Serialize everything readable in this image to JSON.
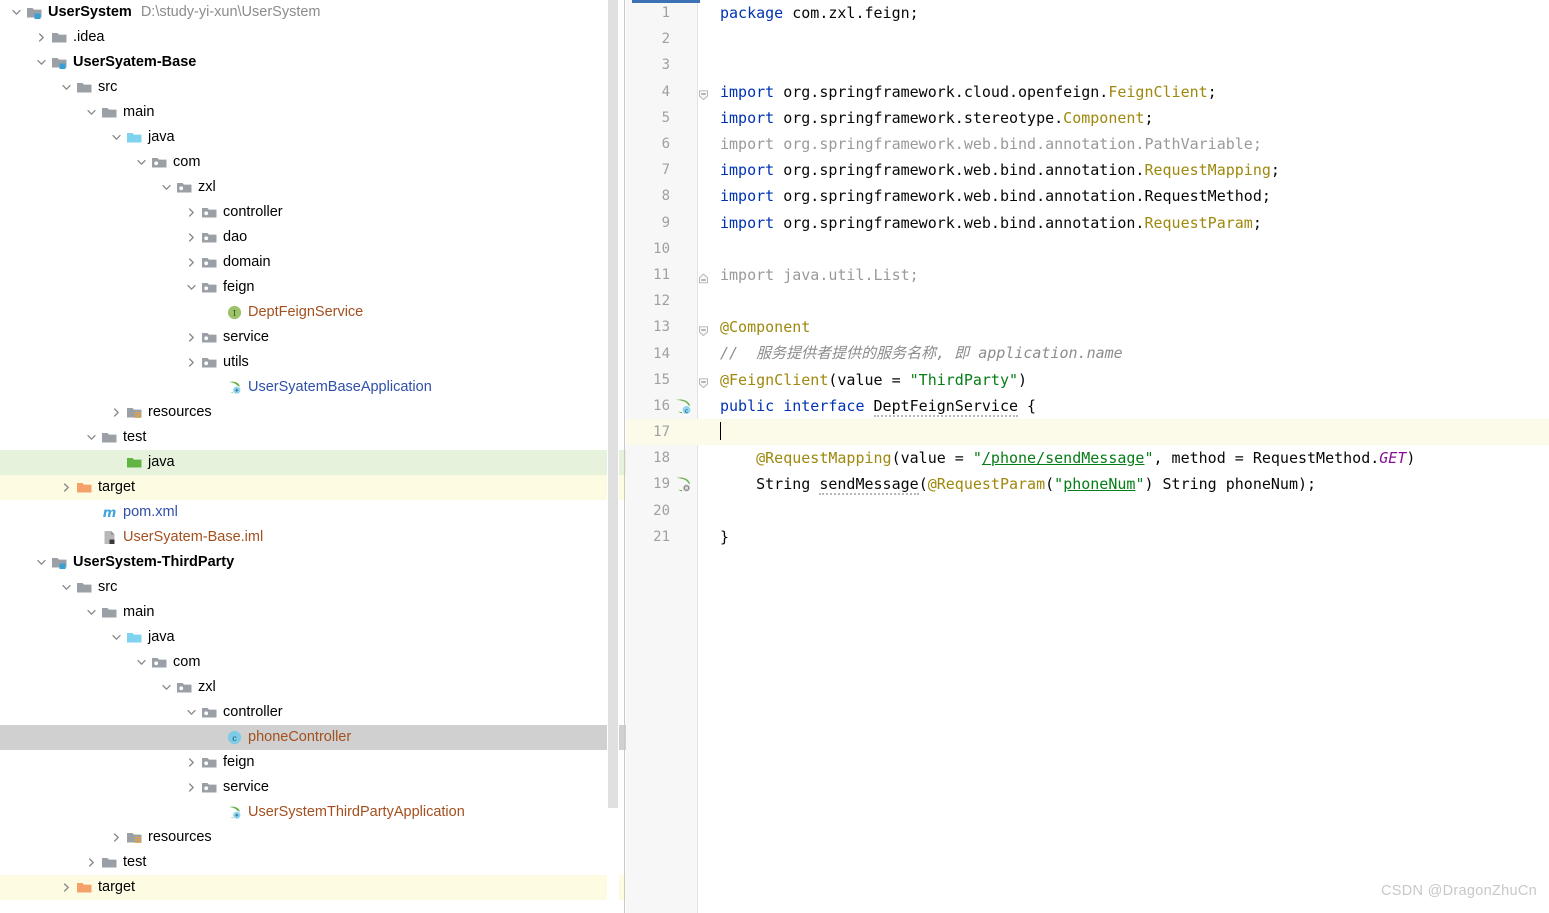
{
  "project_tree": {
    "rows": [
      {
        "indent": 0,
        "arrow": "down",
        "icon": "module-folder",
        "label": "UserSystem",
        "bold": true,
        "path": "D:\\study-yi-xun\\UserSystem",
        "highlight": "none"
      },
      {
        "indent": 1,
        "arrow": "right",
        "icon": "folder-gray",
        "label": ".idea",
        "bold": false,
        "highlight": "none"
      },
      {
        "indent": 1,
        "arrow": "down",
        "icon": "module-folder",
        "label": "UserSyatem-Base",
        "bold": true,
        "highlight": "none"
      },
      {
        "indent": 2,
        "arrow": "down",
        "icon": "folder-gray",
        "label": "src",
        "bold": false,
        "highlight": "none"
      },
      {
        "indent": 3,
        "arrow": "down",
        "icon": "folder-gray",
        "label": "main",
        "bold": false,
        "highlight": "none"
      },
      {
        "indent": 4,
        "arrow": "down",
        "icon": "folder-blue",
        "label": "java",
        "bold": false,
        "highlight": "none"
      },
      {
        "indent": 5,
        "arrow": "down",
        "icon": "package",
        "label": "com",
        "bold": false,
        "highlight": "none"
      },
      {
        "indent": 6,
        "arrow": "down",
        "icon": "package",
        "label": "zxl",
        "bold": false,
        "highlight": "none"
      },
      {
        "indent": 7,
        "arrow": "right",
        "icon": "package",
        "label": "controller",
        "bold": false,
        "highlight": "none"
      },
      {
        "indent": 7,
        "arrow": "right",
        "icon": "package",
        "label": "dao",
        "bold": false,
        "highlight": "none"
      },
      {
        "indent": 7,
        "arrow": "right",
        "icon": "package",
        "label": "domain",
        "bold": false,
        "highlight": "none"
      },
      {
        "indent": 7,
        "arrow": "down",
        "icon": "package",
        "label": "feign",
        "bold": false,
        "highlight": "none"
      },
      {
        "indent": 8,
        "arrow": "none",
        "icon": "interface",
        "label": "DeptFeignService",
        "bold": false,
        "color": "rust",
        "highlight": "none"
      },
      {
        "indent": 7,
        "arrow": "right",
        "icon": "package",
        "label": "service",
        "bold": false,
        "highlight": "none"
      },
      {
        "indent": 7,
        "arrow": "right",
        "icon": "package",
        "label": "utils",
        "bold": false,
        "highlight": "none"
      },
      {
        "indent": 8,
        "arrow": "none",
        "icon": "spring-class",
        "label": "UserSyatemBaseApplication",
        "bold": false,
        "color": "blue",
        "highlight": "none"
      },
      {
        "indent": 4,
        "arrow": "right",
        "icon": "resources",
        "label": "resources",
        "bold": false,
        "highlight": "none"
      },
      {
        "indent": 3,
        "arrow": "down",
        "icon": "folder-gray",
        "label": "test",
        "bold": false,
        "highlight": "none"
      },
      {
        "indent": 4,
        "arrow": "none",
        "icon": "folder-green",
        "label": "java",
        "bold": false,
        "highlight": "green"
      },
      {
        "indent": 2,
        "arrow": "right",
        "icon": "folder-orange",
        "label": "target",
        "bold": false,
        "highlight": "yellow"
      },
      {
        "indent": 3,
        "arrow": "none",
        "icon": "maven",
        "label": "pom.xml",
        "bold": false,
        "color": "blue",
        "highlight": "none"
      },
      {
        "indent": 3,
        "arrow": "none",
        "icon": "iml",
        "label": "UserSyatem-Base.iml",
        "bold": false,
        "color": "rust",
        "highlight": "none"
      },
      {
        "indent": 1,
        "arrow": "down",
        "icon": "module-folder",
        "label": "UserSystem-ThirdParty",
        "bold": true,
        "highlight": "none"
      },
      {
        "indent": 2,
        "arrow": "down",
        "icon": "folder-gray",
        "label": "src",
        "bold": false,
        "highlight": "none"
      },
      {
        "indent": 3,
        "arrow": "down",
        "icon": "folder-gray",
        "label": "main",
        "bold": false,
        "highlight": "none"
      },
      {
        "indent": 4,
        "arrow": "down",
        "icon": "folder-blue",
        "label": "java",
        "bold": false,
        "highlight": "none"
      },
      {
        "indent": 5,
        "arrow": "down",
        "icon": "package",
        "label": "com",
        "bold": false,
        "highlight": "none"
      },
      {
        "indent": 6,
        "arrow": "down",
        "icon": "package",
        "label": "zxl",
        "bold": false,
        "highlight": "none"
      },
      {
        "indent": 7,
        "arrow": "down",
        "icon": "package",
        "label": "controller",
        "bold": false,
        "highlight": "none"
      },
      {
        "indent": 8,
        "arrow": "none",
        "icon": "class",
        "label": "phoneController",
        "bold": false,
        "color": "rust",
        "highlight": "gray"
      },
      {
        "indent": 7,
        "arrow": "right",
        "icon": "package",
        "label": "feign",
        "bold": false,
        "highlight": "none"
      },
      {
        "indent": 7,
        "arrow": "right",
        "icon": "package",
        "label": "service",
        "bold": false,
        "highlight": "none"
      },
      {
        "indent": 8,
        "arrow": "none",
        "icon": "spring-class",
        "label": "UserSystemThirdPartyApplication",
        "bold": false,
        "color": "rust",
        "highlight": "none"
      },
      {
        "indent": 4,
        "arrow": "right",
        "icon": "resources",
        "label": "resources",
        "bold": false,
        "highlight": "none"
      },
      {
        "indent": 3,
        "arrow": "right",
        "icon": "folder-gray",
        "label": "test",
        "bold": false,
        "highlight": "none"
      },
      {
        "indent": 2,
        "arrow": "right",
        "icon": "folder-orange",
        "label": "target",
        "bold": false,
        "highlight": "yellow"
      }
    ]
  },
  "editor": {
    "file_language": "java",
    "caret_line": 17,
    "lines": [
      {
        "n": 1,
        "gutter": "",
        "fold": "",
        "indent": 0,
        "tokens": [
          {
            "t": "package ",
            "c": "kw"
          },
          {
            "t": "com.zxl.feign;",
            "c": ""
          }
        ]
      },
      {
        "n": 2,
        "gutter": "",
        "fold": "",
        "indent": 0,
        "tokens": []
      },
      {
        "n": 3,
        "gutter": "",
        "fold": "",
        "indent": 0,
        "tokens": []
      },
      {
        "n": 4,
        "gutter": "",
        "fold": "open",
        "indent": 0,
        "tokens": [
          {
            "t": "import",
            "c": "kw"
          },
          {
            "t": " org.springframework.cloud.openfeign.",
            "c": ""
          },
          {
            "t": "FeignClient",
            "c": "cls"
          },
          {
            "t": ";",
            "c": ""
          }
        ]
      },
      {
        "n": 5,
        "gutter": "",
        "fold": "",
        "indent": 0,
        "tokens": [
          {
            "t": "import",
            "c": "kw"
          },
          {
            "t": " org.springframework.stereotype.",
            "c": ""
          },
          {
            "t": "Component",
            "c": "cls"
          },
          {
            "t": ";",
            "c": ""
          }
        ]
      },
      {
        "n": 6,
        "gutter": "",
        "fold": "",
        "indent": 0,
        "tokens": [
          {
            "t": "import org.springframework.web.bind.annotation.PathVariable;",
            "c": "gray"
          }
        ]
      },
      {
        "n": 7,
        "gutter": "",
        "fold": "",
        "indent": 0,
        "tokens": [
          {
            "t": "import",
            "c": "kw"
          },
          {
            "t": " org.springframework.web.bind.annotation.",
            "c": ""
          },
          {
            "t": "RequestMapping",
            "c": "cls"
          },
          {
            "t": ";",
            "c": ""
          }
        ]
      },
      {
        "n": 8,
        "gutter": "",
        "fold": "",
        "indent": 0,
        "tokens": [
          {
            "t": "import",
            "c": "kw"
          },
          {
            "t": " org.springframework.web.bind.annotation.RequestMethod;",
            "c": ""
          }
        ]
      },
      {
        "n": 9,
        "gutter": "",
        "fold": "",
        "indent": 0,
        "tokens": [
          {
            "t": "import",
            "c": "kw"
          },
          {
            "t": " org.springframework.web.bind.annotation.",
            "c": ""
          },
          {
            "t": "RequestParam",
            "c": "cls"
          },
          {
            "t": ";",
            "c": ""
          }
        ]
      },
      {
        "n": 10,
        "gutter": "",
        "fold": "",
        "indent": 0,
        "tokens": []
      },
      {
        "n": 11,
        "gutter": "",
        "fold": "close",
        "indent": 0,
        "tokens": [
          {
            "t": "import java.util.List;",
            "c": "gray"
          }
        ]
      },
      {
        "n": 12,
        "gutter": "",
        "fold": "",
        "indent": 0,
        "tokens": []
      },
      {
        "n": 13,
        "gutter": "",
        "fold": "open",
        "indent": 0,
        "tokens": [
          {
            "t": "@Component",
            "c": "anno"
          }
        ]
      },
      {
        "n": 14,
        "gutter": "",
        "fold": "",
        "indent": 0,
        "tokens": [
          {
            "t": "//  服务提供者提供的服务名称, 即 application.name",
            "c": "cmt"
          }
        ]
      },
      {
        "n": 15,
        "gutter": "",
        "fold": "open",
        "indent": 0,
        "tokens": [
          {
            "t": "@FeignClient",
            "c": "anno"
          },
          {
            "t": "(value = ",
            "c": ""
          },
          {
            "t": "\"ThirdParty\"",
            "c": "str"
          },
          {
            "t": ")",
            "c": ""
          }
        ]
      },
      {
        "n": 16,
        "gutter": "spring-bean",
        "fold": "",
        "indent": 0,
        "tokens": [
          {
            "t": "public interface ",
            "c": "kw"
          },
          {
            "t": "DeptFeignService",
            "c": "squig"
          },
          {
            "t": " {",
            "c": ""
          }
        ]
      },
      {
        "n": 17,
        "gutter": "",
        "fold": "",
        "indent": 0,
        "caret": true,
        "tokens": []
      },
      {
        "n": 18,
        "gutter": "",
        "fold": "",
        "indent": 1,
        "tokens": [
          {
            "t": "@RequestMapping",
            "c": "anno"
          },
          {
            "t": "(value = ",
            "c": ""
          },
          {
            "t": "\"",
            "c": "str"
          },
          {
            "t": "/phone/sendMessage",
            "c": "str ul"
          },
          {
            "t": "\"",
            "c": "str"
          },
          {
            "t": ", method = RequestMethod.",
            "c": ""
          },
          {
            "t": "GET",
            "c": "stat"
          },
          {
            "t": ")",
            "c": ""
          }
        ]
      },
      {
        "n": 19,
        "gutter": "spring-method",
        "fold": "",
        "indent": 1,
        "tokens": [
          {
            "t": "String ",
            "c": ""
          },
          {
            "t": "sendMessage",
            "c": "squig"
          },
          {
            "t": "(",
            "c": ""
          },
          {
            "t": "@RequestParam",
            "c": "anno"
          },
          {
            "t": "(",
            "c": ""
          },
          {
            "t": "\"",
            "c": "str"
          },
          {
            "t": "phoneNum",
            "c": "str ul"
          },
          {
            "t": "\"",
            "c": "str"
          },
          {
            "t": ") String phoneNum);",
            "c": ""
          }
        ]
      },
      {
        "n": 20,
        "gutter": "",
        "fold": "",
        "indent": 0,
        "tokens": []
      },
      {
        "n": 21,
        "gutter": "",
        "fold": "",
        "indent": 0,
        "tokens": [
          {
            "t": "}",
            "c": ""
          }
        ]
      }
    ]
  },
  "watermark": {
    "text": "CSDN @DragonZhuCn"
  },
  "colors": {
    "keyword": "#0033b3",
    "string": "#067d17",
    "annotation": "#9e880d",
    "comment": "#8c8c8c",
    "grayed_out": "#9a9a9a",
    "static_field": "#871094",
    "selection_gray": "#d0d0d0",
    "highlight_green": "#e7f2dd",
    "highlight_yellow": "#fdfce3",
    "current_line": "#fcfbe9",
    "gutter_bg": "#f7f7f7",
    "tab_accent": "#3c72b5"
  }
}
